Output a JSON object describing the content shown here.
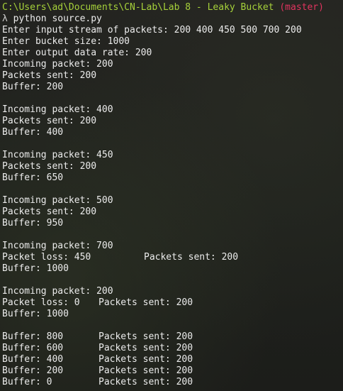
{
  "prompt": {
    "path": "C:\\Users\\ad\\Documents\\CN-Lab\\Lab 8 - Leaky Bucket",
    "branch": "(master)",
    "symbol": "λ",
    "command": "python source.py"
  },
  "inputs": [
    "Enter input stream of packets: 200 400 450 500 700 200",
    "Enter bucket size: 1000",
    "Enter output data rate: 200"
  ],
  "blocks": [
    [
      "Incoming packet: 200",
      "Packets sent: 200",
      "Buffer: 200"
    ],
    [
      "Incoming packet: 400",
      "Packets sent: 200",
      "Buffer: 400"
    ],
    [
      "Incoming packet: 450",
      "Packets sent: 200",
      "Buffer: 650"
    ],
    [
      "Incoming packet: 500",
      "Packets sent: 200",
      "Buffer: 950"
    ]
  ],
  "loss_block_1": {
    "incoming": "Incoming packet: 700",
    "loss": "Packet loss: 450",
    "sent": "Packets sent: 200",
    "buffer": "Buffer: 1000"
  },
  "loss_block_2": {
    "incoming": "Incoming packet: 200",
    "loss": "Packet loss: 0",
    "sent": "Packets sent: 200",
    "buffer": "Buffer: 1000"
  },
  "drain": [
    {
      "buffer": "Buffer: 800",
      "sent": "Packets sent: 200"
    },
    {
      "buffer": "Buffer: 600",
      "sent": "Packets sent: 200"
    },
    {
      "buffer": "Buffer: 400",
      "sent": "Packets sent: 200"
    },
    {
      "buffer": "Buffer: 200",
      "sent": "Packets sent: 200"
    },
    {
      "buffer": "Buffer: 0",
      "sent": "Packets sent: 200"
    }
  ]
}
